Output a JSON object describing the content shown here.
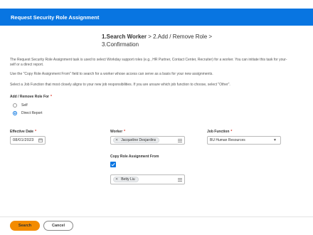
{
  "header": {
    "title": "Request Security Role Assignment"
  },
  "steps": {
    "step1": "1.Search Worker",
    "step2": " > 2.Add / Remove Role > ",
    "step3": "3.Confirmation"
  },
  "instructions": {
    "p1a": "The Request Security Role Assignment task is used to select Workday support roles (e.g., HR Partner, Contact Center, Recruiter) for a worker.  You can initiate this task for your-",
    "p1b": "self or a direct report.",
    "p2": "Use the \"Copy Role Assignment From\" field to search for a worker whose access can serve as a basis for your new assignments.",
    "p3": "Select a Job Function that most closely aligns to your new job responsibilities.  If you are unsure which job function to choose, select \"Other\"."
  },
  "add_remove": {
    "label": "Add / Remove Role For",
    "required_mark": "*",
    "options": [
      "Self",
      "Direct Report"
    ],
    "selected": "Direct Report"
  },
  "effective_date": {
    "label": "Effective Date",
    "required_mark": "*",
    "value": "08/01/2023",
    "icon": "calendar-icon"
  },
  "worker": {
    "label": "Worker",
    "required_mark": "*",
    "value": "Jacqueline Desjardins",
    "icon": "list-icon"
  },
  "job_function": {
    "label": "Job Function",
    "required_mark": "*",
    "value": "BU Human Resources",
    "icon": "chevron-down-icon"
  },
  "copy_role": {
    "label": "Copy Role Assignment From",
    "checked": true,
    "value": "Betty Liu",
    "icon": "list-icon"
  },
  "footer": {
    "search_label": "Search",
    "cancel_label": "Cancel"
  },
  "colors": {
    "header": "#0875e1",
    "primary_button": "#f38b00",
    "required": "#de2e21"
  }
}
